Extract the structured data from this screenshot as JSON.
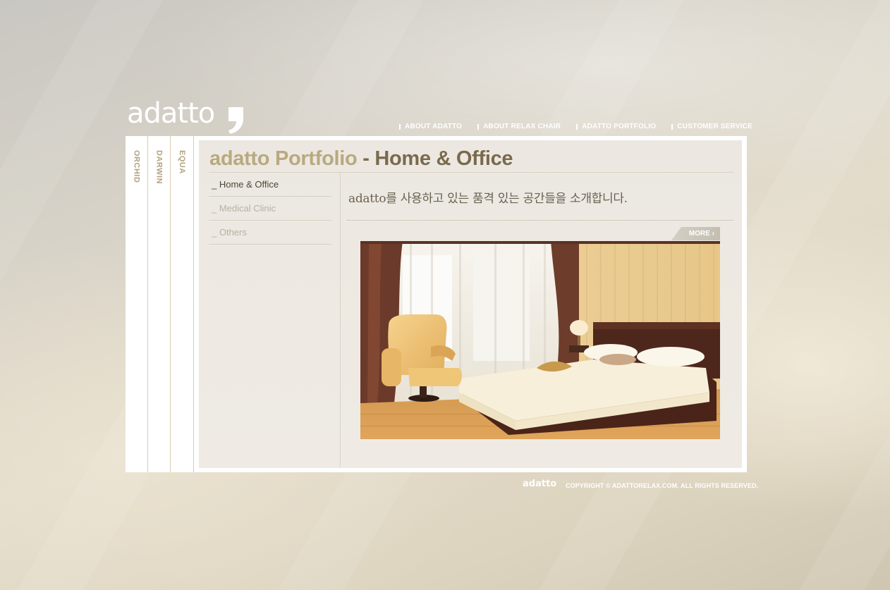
{
  "brand": {
    "logo_text": "adatto"
  },
  "top_nav": {
    "items": [
      {
        "label": "ABOUT ADATTO"
      },
      {
        "label": "ABOUT RELAX CHAIR"
      },
      {
        "label": "ADATTO PORTFOLIO"
      },
      {
        "label": "CUSTOMER SERVICE"
      }
    ]
  },
  "side_tabs": {
    "items": [
      {
        "label": "ORCHID"
      },
      {
        "label": "DARWIN"
      },
      {
        "label": "EQUA"
      }
    ]
  },
  "page": {
    "title_main": "adatto Portfolio",
    "title_sub": "- Home & Office",
    "intro": "adatto를 사용하고 있는 품격 있는 공간들을 소개합니다.",
    "more_label": "MORE ›",
    "photo_name": "bedroom-with-relax-chair"
  },
  "sub_nav": {
    "items": [
      {
        "label": "_ Home & Office",
        "active": true
      },
      {
        "label": "_ Medical Clinic",
        "active": false
      },
      {
        "label": "_ Others",
        "active": false
      }
    ]
  },
  "footer": {
    "logo_text": "adatto",
    "copyright": "COPYRIGHT © ADATTORELAX.COM. ALL RIGHTS RESERVED."
  },
  "colors": {
    "accent_light": "#b9a97f",
    "accent_dark": "#7a6a4d",
    "tab_text": "#b3a27d"
  }
}
